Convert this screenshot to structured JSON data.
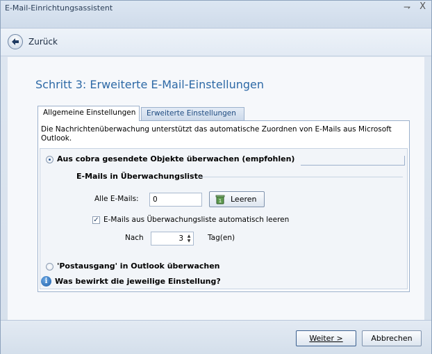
{
  "window": {
    "title": "E-Mail-Einrichtungsassistent",
    "pin_glyph": "⇁",
    "close_glyph": "X"
  },
  "nav": {
    "back_label": "Zurück"
  },
  "step_title": "Schritt 3: Erweiterte E-Mail-Einstellungen",
  "tabs": [
    {
      "label": "Allgemeine Einstellungen",
      "active": true
    },
    {
      "label": "Erweiterte Einstellungen",
      "active": false
    }
  ],
  "description": "Die Nachrichtenüberwachung unterstützt das automatische Zuordnen von E-Mails aus Microsoft Outlook.",
  "options": {
    "radio1_label": "Aus cobra gesendete Objekte überwachen (empfohlen)",
    "radio1_checked": true,
    "group_title": "E-Mails in Überwachungsliste",
    "all_emails_label": "Alle E-Mails:",
    "all_emails_value": "0",
    "clear_button_label": "Leeren",
    "auto_clear_label": "E-Mails aus Überwachungsliste automatisch leeren",
    "auto_clear_checked": true,
    "after_label": "Nach",
    "days_value": "3",
    "days_unit": "Tag(en)",
    "radio2_label": "'Postausgang' in Outlook überwachen",
    "radio2_checked": false,
    "help_label": "Was bewirkt die jeweilige Einstellung?"
  },
  "footer": {
    "next_label": "Weiter >",
    "cancel_label": "Abbrechen"
  },
  "colors": {
    "accent_title": "#2d69a6",
    "tab_inactive_text": "#1d4a80"
  },
  "icons": {
    "back": "back-arrow-icon",
    "clear": "trash-icon",
    "info": "info-icon"
  }
}
